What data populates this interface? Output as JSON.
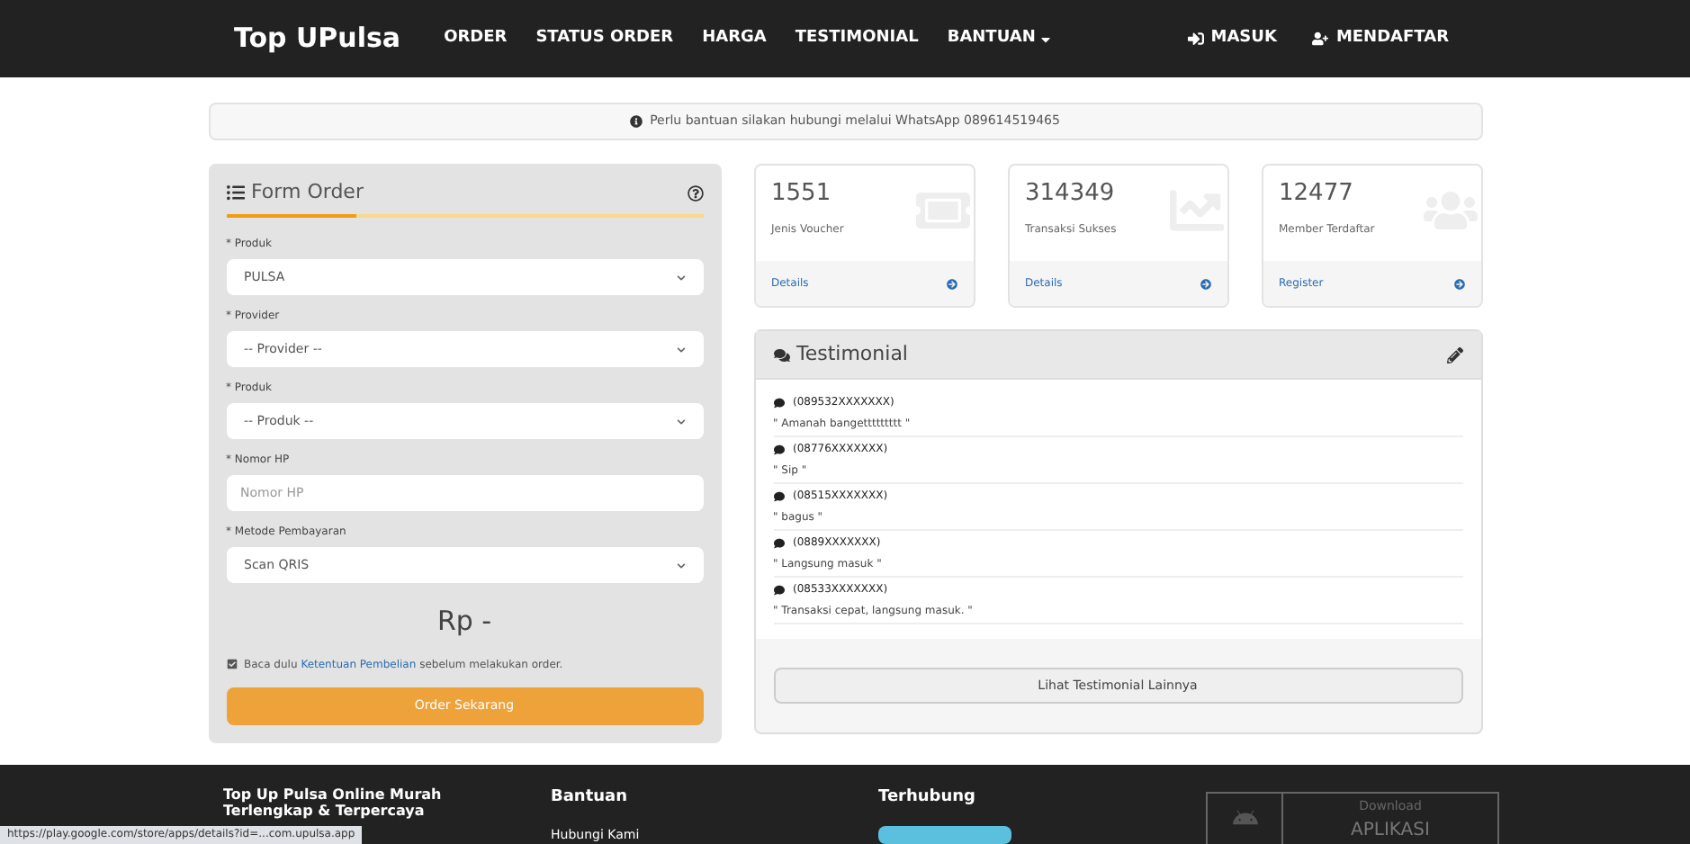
{
  "navbar": {
    "brand": "Top UPulsa",
    "menu": [
      {
        "label": "ORDER",
        "dropdown": false
      },
      {
        "label": "STATUS ORDER",
        "dropdown": false
      },
      {
        "label": "HARGA",
        "dropdown": false
      },
      {
        "label": "TESTIMONIAL",
        "dropdown": false
      },
      {
        "label": "BANTUAN",
        "dropdown": true
      }
    ],
    "right": [
      {
        "label": "MASUK",
        "kind": "login"
      },
      {
        "label": "MENDAFTAR",
        "kind": "register"
      }
    ]
  },
  "notice": "Perlu bantuan silakan hubungi melalui WhatsApp 089614519465",
  "form": {
    "title": "Form Order",
    "fields": [
      {
        "label": "* Produk",
        "kind": "select",
        "value": "PULSA"
      },
      {
        "label": "* Provider",
        "kind": "select",
        "value": "-- Provider --"
      },
      {
        "label": "* Produk",
        "kind": "select",
        "value": "-- Produk --"
      },
      {
        "label": "* Nomor HP",
        "kind": "input",
        "placeholder": "Nomor HP"
      },
      {
        "label": "* Metode Pembayaran",
        "kind": "select",
        "value": "Scan QRIS"
      }
    ],
    "price": "Rp -",
    "agree": {
      "checked": true,
      "before": "Baca dulu",
      "link": "Ketentuan Pembelian",
      "after": "sebelum melakukan order."
    },
    "submit": "Order Sekarang"
  },
  "stats": [
    {
      "value": "1551",
      "label": "Jenis Voucher",
      "link": "Details",
      "kind": "ticket"
    },
    {
      "value": "314349",
      "label": "Transaksi Sukses",
      "link": "Details",
      "kind": "chart"
    },
    {
      "value": "12477",
      "label": "Member Terdaftar",
      "link": "Register",
      "kind": "users"
    }
  ],
  "testimonial": {
    "title": "Testimonial",
    "items": [
      {
        "phone": "(089532XXXXXXX)",
        "text": "\" Amanah bangettttttttt \""
      },
      {
        "phone": "(08776XXXXXXX)",
        "text": "\" Sip \""
      },
      {
        "phone": "(08515XXXXXXX)",
        "text": "\" bagus \""
      },
      {
        "phone": "(0889XXXXXXX)",
        "text": "\" Langsung masuk \""
      },
      {
        "phone": "(08533XXXXXXX)",
        "text": "\" Transaksi cepat, langsung masuk. \""
      }
    ],
    "more": "Lihat Testimonial Lainnya"
  },
  "footer": {
    "about": "Top Up Pulsa Online Murah Terlengkap & Terpercaya",
    "columns": [
      {
        "title": "Bantuan",
        "link": "Hubungi Kami"
      },
      {
        "title": "Terhubung"
      }
    ],
    "app": {
      "small": "Download",
      "big": "APLIKASI"
    }
  },
  "status_url": "https://play.google.com/store/apps/details?id=...com.upulsa.app"
}
